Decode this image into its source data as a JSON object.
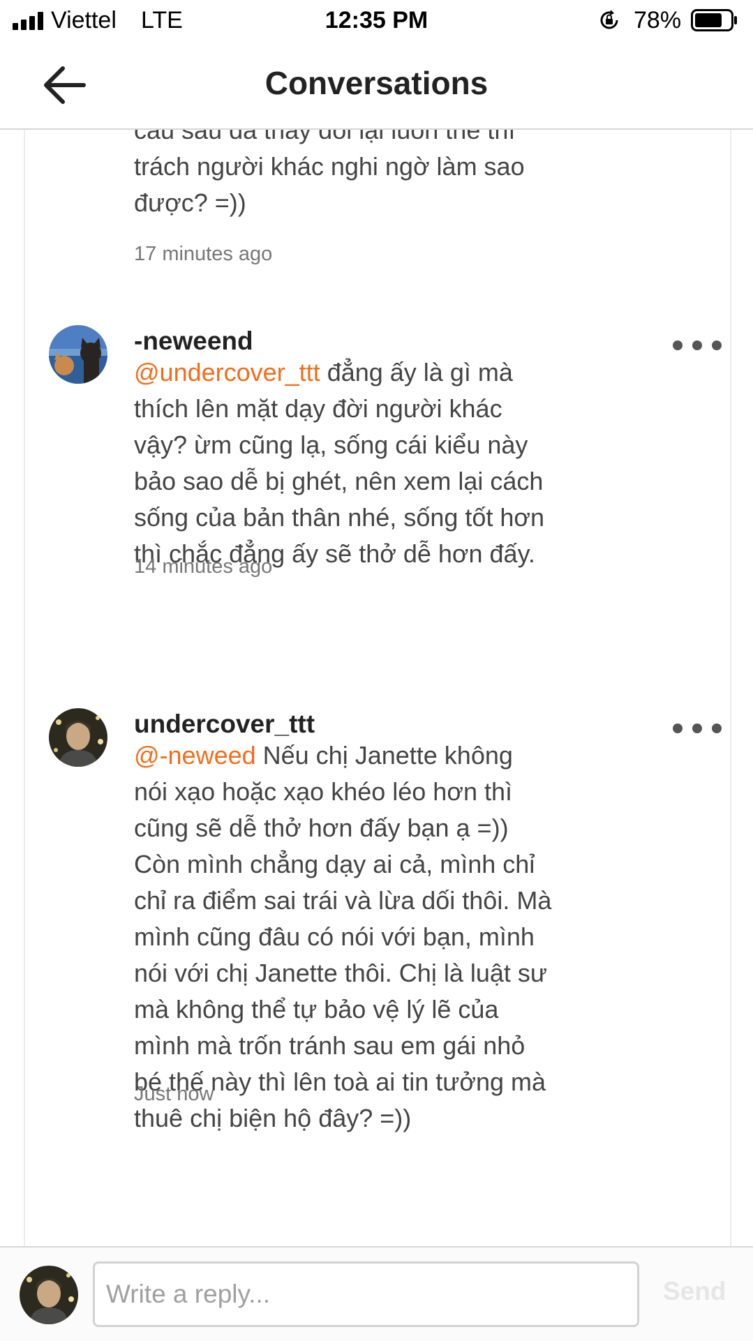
{
  "status_bar": {
    "carrier": "Viettel",
    "network": "LTE",
    "time": "12:35 PM",
    "battery_percent": "78%",
    "battery_level": 0.78,
    "icons": [
      "signal-icon",
      "rotation-lock-icon",
      "battery-icon"
    ]
  },
  "header": {
    "title": "Conversations",
    "back_icon": "arrow-left-icon"
  },
  "messages": [
    {
      "username": "",
      "mention": "",
      "text": "câu sau đã thay đổi lại luôn thế thì trách người khác nghi ngờ làm sao được? =))",
      "time": "17 minutes ago"
    },
    {
      "username": "-neweend",
      "mention": "@undercover_ttt",
      "text": " đẳng ấy là gì mà thích lên mặt dạy đời người khác vậy? ừm cũng lạ, sống cái kiểu này bảo sao dễ bị ghét, nên xem lại cách sống của bản thân nhé, sống tốt hơn thì chắc đẳng ấy sẽ thở dễ hơn đấy.",
      "time": "14 minutes ago",
      "more_icon": "more-horizontal-icon"
    },
    {
      "username": "undercover_ttt",
      "mention": "@-neweed",
      "text": " Nếu chị Janette không nói xạo hoặc xạo khéo léo hơn thì cũng sẽ dễ thở hơn đấy bạn ạ =)) Còn mình chẳng dạy ai cả, mình chỉ chỉ ra điểm sai trái và lừa dối thôi. Mà mình cũng đâu có nói với bạn, mình nói với chị Janette thôi. Chị là luật sư mà không thể tự bảo vệ lý lẽ của mình mà trốn tránh sau em gái nhỏ bé thế này thì lên toà ai tin tưởng mà thuê chị biện hộ đây? =))",
      "time": "Just now",
      "more_icon": "more-horizontal-icon"
    }
  ],
  "composer": {
    "placeholder": "Write a reply...",
    "send_label": "Send"
  },
  "colors": {
    "mention": "#f26d1a",
    "divider": "#d7d7d7",
    "send_disabled": "#e6e6e6"
  }
}
